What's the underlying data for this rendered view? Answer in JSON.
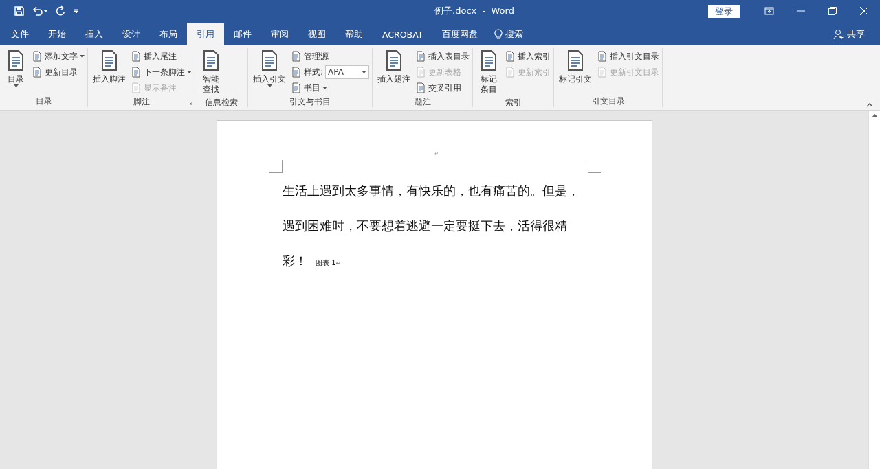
{
  "window": {
    "title": "例子.docx  -  Word",
    "login": "登录"
  },
  "tabs": [
    {
      "label": "文件",
      "selected": false
    },
    {
      "label": "开始",
      "selected": false
    },
    {
      "label": "插入",
      "selected": false
    },
    {
      "label": "设计",
      "selected": false
    },
    {
      "label": "布局",
      "selected": false
    },
    {
      "label": "引用",
      "selected": true
    },
    {
      "label": "邮件",
      "selected": false
    },
    {
      "label": "审阅",
      "selected": false
    },
    {
      "label": "视图",
      "selected": false
    },
    {
      "label": "帮助",
      "selected": false
    },
    {
      "label": "ACROBAT",
      "selected": false
    },
    {
      "label": "百度网盘",
      "selected": false
    }
  ],
  "search": {
    "label": "搜索"
  },
  "share": {
    "label": "共享"
  },
  "ribbon": {
    "groups": [
      {
        "label": "目录",
        "launcher": false,
        "items": [
          {
            "kind": "large",
            "label": "目录",
            "dropdown": true,
            "disabled": false
          },
          {
            "kind": "stack",
            "items": [
              {
                "label": "添加文字",
                "dropdown": true,
                "disabled": false
              },
              {
                "label": "更新目录",
                "dropdown": false,
                "disabled": false
              }
            ]
          }
        ]
      },
      {
        "label": "脚注",
        "launcher": true,
        "items": [
          {
            "kind": "large",
            "label": "插入脚注",
            "dropdown": false,
            "disabled": false
          },
          {
            "kind": "stack",
            "items": [
              {
                "label": "插入尾注",
                "dropdown": false,
                "disabled": false
              },
              {
                "label": "下一条脚注",
                "dropdown": true,
                "disabled": false
              },
              {
                "label": "显示备注",
                "dropdown": false,
                "disabled": true
              }
            ]
          }
        ]
      },
      {
        "label": "信息检索",
        "launcher": false,
        "items": [
          {
            "kind": "large",
            "label": [
              "智能",
              "查找"
            ],
            "dropdown": false,
            "disabled": false
          }
        ]
      },
      {
        "label": "引文与书目",
        "launcher": false,
        "items": [
          {
            "kind": "large",
            "label": "插入引文",
            "dropdown": true,
            "disabled": false
          },
          {
            "kind": "stack",
            "items": [
              {
                "label": "管理源",
                "dropdown": false,
                "disabled": false
              },
              {
                "label": "样式:",
                "select": "APA",
                "dropdown": false,
                "disabled": false
              },
              {
                "label": "书目",
                "dropdown": true,
                "disabled": false
              }
            ]
          }
        ]
      },
      {
        "label": "题注",
        "launcher": false,
        "items": [
          {
            "kind": "large",
            "label": "插入题注",
            "dropdown": false,
            "disabled": false
          },
          {
            "kind": "stack",
            "items": [
              {
                "label": "插入表目录",
                "dropdown": false,
                "disabled": false
              },
              {
                "label": "更新表格",
                "dropdown": false,
                "disabled": true
              },
              {
                "label": "交叉引用",
                "dropdown": false,
                "disabled": false
              }
            ]
          }
        ]
      },
      {
        "label": "索引",
        "launcher": false,
        "items": [
          {
            "kind": "large",
            "label": [
              "标记",
              "条目"
            ],
            "dropdown": false,
            "disabled": false
          },
          {
            "kind": "stack",
            "items": [
              {
                "label": "插入索引",
                "dropdown": false,
                "disabled": false
              },
              {
                "label": "更新索引",
                "dropdown": false,
                "disabled": true
              }
            ]
          }
        ]
      },
      {
        "label": "引文目录",
        "launcher": false,
        "items": [
          {
            "kind": "large",
            "label": "标记引文",
            "dropdown": false,
            "disabled": false
          },
          {
            "kind": "stack",
            "items": [
              {
                "label": "插入引文目录",
                "dropdown": false,
                "disabled": false
              },
              {
                "label": "更新引文目录",
                "dropdown": false,
                "disabled": true
              }
            ]
          }
        ]
      }
    ]
  },
  "document": {
    "header_mark": "↵",
    "lines": [
      "生活上遇到太多事情，有快乐的，也有痛苦的。但是，",
      "遇到困难时，不要想着逃避一定要挺下去，活得很精",
      "彩！"
    ],
    "caption": "图表 1",
    "paragraph_mark": "↵"
  }
}
